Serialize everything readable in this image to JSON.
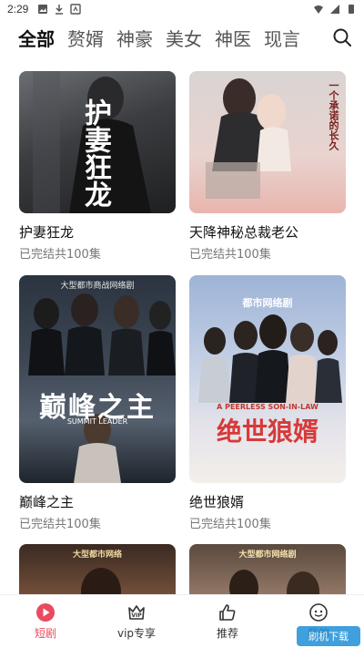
{
  "status_bar": {
    "time": "2:29"
  },
  "tabs": [
    {
      "label": "全部",
      "active": true
    },
    {
      "label": "赘婿",
      "active": false
    },
    {
      "label": "神豪",
      "active": false
    },
    {
      "label": "美女",
      "active": false
    },
    {
      "label": "神医",
      "active": false
    },
    {
      "label": "现言",
      "active": false
    }
  ],
  "dramas": [
    {
      "title": "护妻狂龙",
      "status": "已完结共100集",
      "poster_text": "护妻狂龙"
    },
    {
      "title": "天降神秘总裁老公",
      "status": "已完结共100集",
      "poster_text": "一个承诺的长久"
    },
    {
      "title": "巅峰之主",
      "status": "已完结共100集",
      "poster_text": "巅峰之主",
      "poster_banner": "大型都市商战网络剧",
      "poster_subtitle": "SUMMIT LEADER"
    },
    {
      "title": "绝世狼婿",
      "status": "已完结共100集",
      "poster_text": "绝世狼婿",
      "poster_banner": "都市网络剧",
      "poster_subtitle": "A PEERLESS SON-IN-LAW"
    },
    {
      "poster_banner": "大型都市网络"
    },
    {
      "poster_banner": "大型都市网络剧"
    }
  ],
  "bottom_nav": [
    {
      "label": "短剧",
      "icon": "play-circle-icon",
      "active": true
    },
    {
      "label": "vip专享",
      "icon": "vip-crown-icon",
      "active": false
    },
    {
      "label": "推荐",
      "icon": "thumbs-up-icon",
      "active": false
    },
    {
      "label": "我的",
      "icon": "smile-face-icon",
      "active": false
    }
  ],
  "watermark": "刷机下载",
  "colors": {
    "accent": "#e94a5f",
    "text": "#111111",
    "subtext": "#777777"
  }
}
